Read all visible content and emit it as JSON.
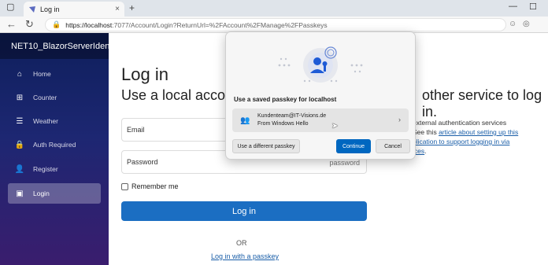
{
  "browser": {
    "tab_title": "Log in",
    "tab_close": "×",
    "new_tab": "+",
    "minimize": "—",
    "maximize": "☐",
    "back": "←",
    "reload": "↻",
    "url_host": "https://localhost",
    "url_path": ":7077/Account/Login?ReturnUrl=%2FAccount%2FManage%2FPasskeys"
  },
  "sidebar": {
    "app_name": "NET10_BlazorServerIdentity",
    "items": [
      {
        "label": "Home",
        "icon": "home-icon",
        "glyph": "⌂"
      },
      {
        "label": "Counter",
        "icon": "plus-square-icon",
        "glyph": "⊞"
      },
      {
        "label": "Weather",
        "icon": "list-icon",
        "glyph": "☰"
      },
      {
        "label": "Auth Required",
        "icon": "lock-icon",
        "glyph": "🔒"
      },
      {
        "label": "Register",
        "icon": "person-icon",
        "glyph": "👤"
      },
      {
        "label": "Login",
        "icon": "person-badge-icon",
        "glyph": "▣"
      }
    ]
  },
  "main": {
    "title": "Log in",
    "subtitle_left": "Use a local accou",
    "subtitle_right": "other service to log in.",
    "email_label": "Email",
    "password_label": "Password",
    "password_placeholder": "password",
    "remember_me": "Remember me",
    "login_button": "Log in",
    "or_text": "OR",
    "passkey_link": "Log in with a passkey",
    "ext_line1": "external authentication services",
    "ext_line2_pre": "See this ",
    "ext_link1": "article about setting up this",
    "ext_link2": "plication to support logging in via",
    "ext_link3": "ices",
    "ext_end": "."
  },
  "dialog": {
    "title": "Use a saved passkey for localhost",
    "account_email": "Kundenteam@IT-Visions.de",
    "account_source": "From Windows Hello",
    "different_button": "Use a different passkey",
    "continue_button": "Continue",
    "cancel_button": "Cancel"
  },
  "colors": {
    "primary": "#1b6ec2",
    "dialog_primary": "#0067c0",
    "link": "#1a5ea8",
    "sidebar_top": "#0e1f5c",
    "sidebar_bottom": "#3a1d6e"
  }
}
